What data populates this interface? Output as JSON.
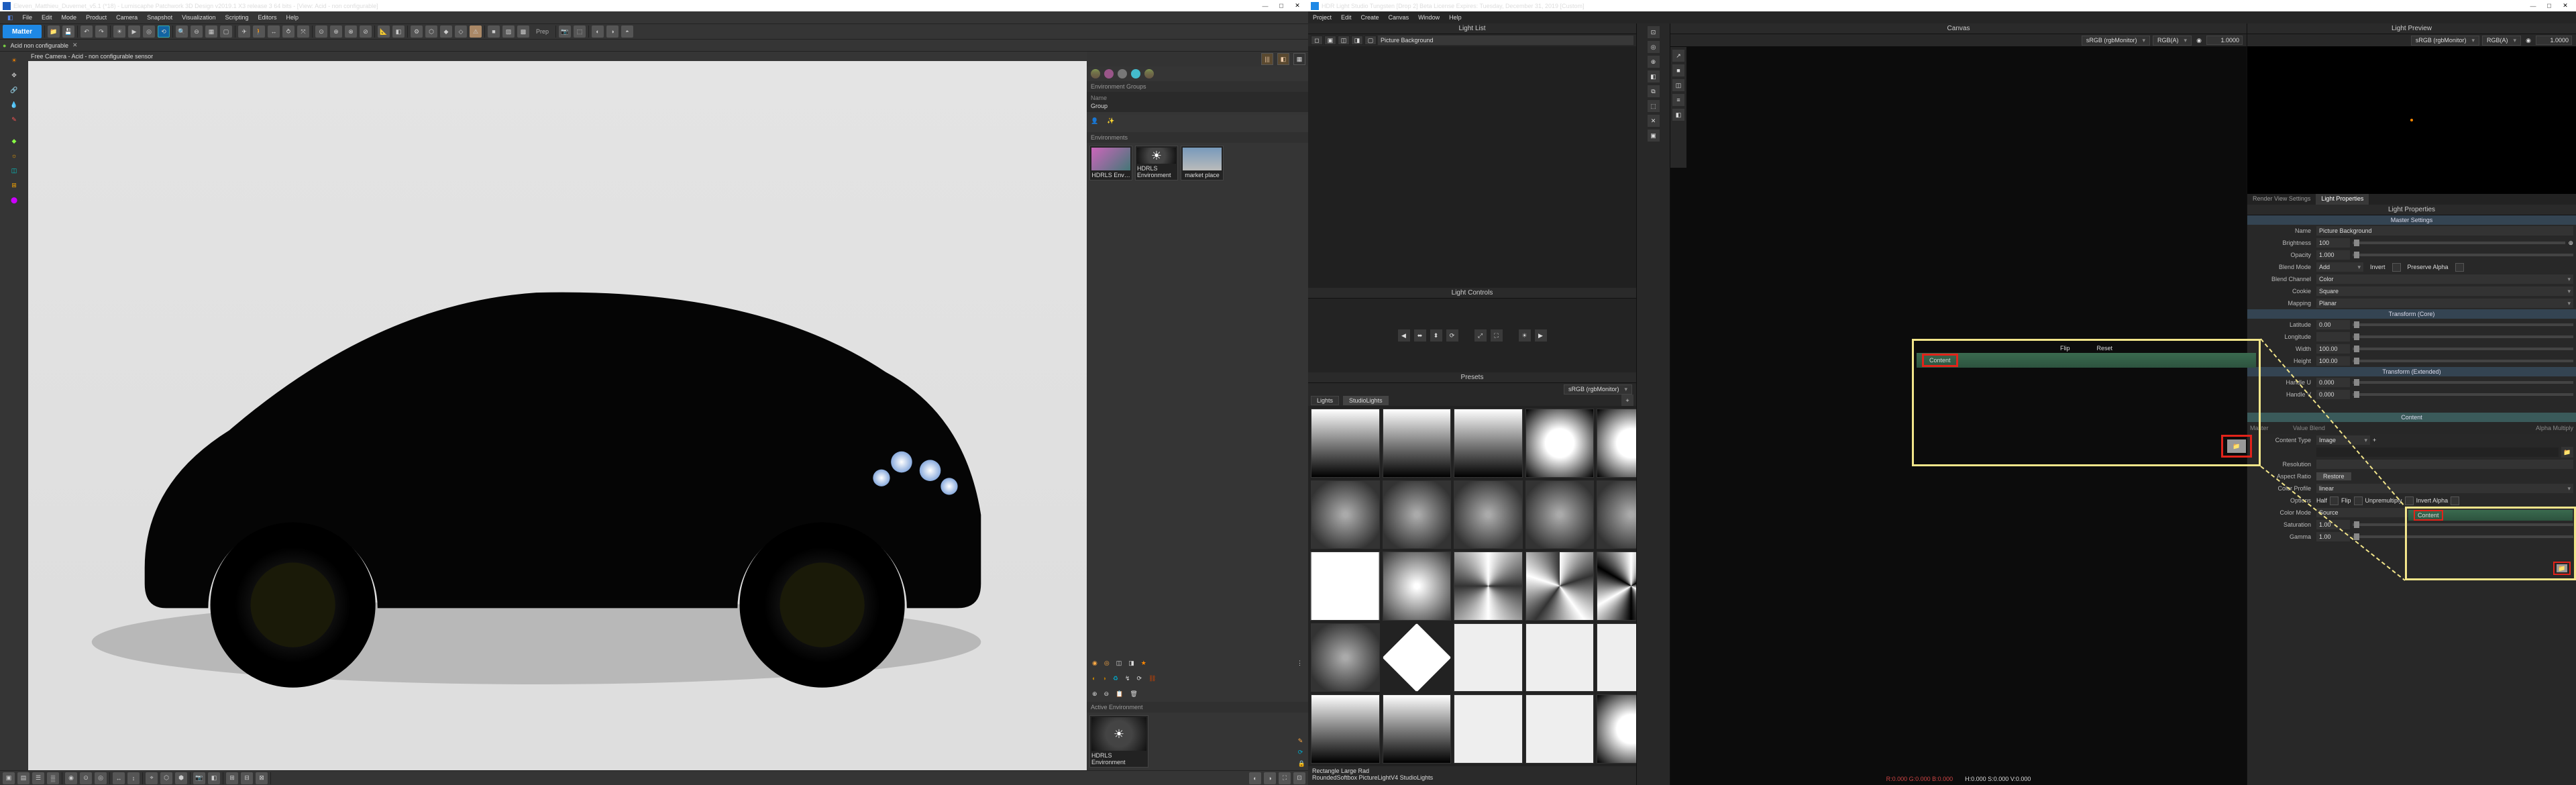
{
  "left": {
    "title": "Eleven_Matthieu_Duvernet_v5.1 (*18) - Lumiscaphe Patchwork 3D Design v2019.1 X3 release 3  64 bits - [View: Acid - non configurable]",
    "menu": [
      "File",
      "Edit",
      "Mode",
      "Product",
      "Camera",
      "Snapshot",
      "Visualization",
      "Scripting",
      "Editors",
      "Help"
    ],
    "matter_btn": "Matter",
    "breadcrumb": "Acid  non configurable",
    "viewport_header": "Free Camera - Acid - non configurable sensor",
    "envgroups_label": "Environment Groups",
    "env_name_label": "Name",
    "env_name_value": "Group",
    "environments_label": "Environments",
    "env_thumbs": [
      {
        "name": "HDRLS Env…"
      },
      {
        "name": "HDRLS Environment"
      },
      {
        "name": "market place"
      }
    ],
    "active_env_label": "Active Environment",
    "active_env_name": "HDRLS Environment"
  },
  "right": {
    "title": "HDR Light Studio Tungsten [Drop 2] Beta License Expires: Tuesday, December 31, 2019  [Custom]",
    "menu": [
      "Project",
      "Edit",
      "Create",
      "Canvas",
      "Window",
      "Help"
    ],
    "panels": {
      "light_list": "Light List",
      "light_controls": "Light Controls",
      "presets": "Presets",
      "canvas": "Canvas",
      "light_preview": "Light Preview",
      "render_view_settings": "Render View Settings",
      "light_properties": "Light Properties"
    },
    "light_list_item": "Picture Background",
    "presets_segments": [
      "Lights",
      "StudioLights"
    ],
    "presets_colorspace": "sRGB (rgbMonitor)",
    "preset_selected_name": "Rectangle Large Rad",
    "preset_selected_path": "RoundedSoftbox PictureLightV4 StudioLights",
    "canvas": {
      "colorspace": "sRGB (rgbMonitor)",
      "channel": "RGB(A)",
      "exposure": "1.0000",
      "rgb": "R:0.000 G:0.000 B:0.000",
      "coords_h": "H:0.000 S:0.000 V:0.000"
    },
    "preview": {
      "colorspace": "sRGB (rgbMonitor)",
      "channel": "RGB(A)",
      "exposure": "1.0000"
    },
    "props": {
      "master_settings": "Master Settings",
      "name_label": "Name",
      "name_value": "Picture Background",
      "brightness_label": "Brightness",
      "brightness_value": "100",
      "opacity_label": "Opacity",
      "opacity_value": "1.000",
      "blend_mode_label": "Blend Mode",
      "blend_mode_value": "Add",
      "invert_label": "Invert",
      "preserve_alpha_label": "Preserve Alpha",
      "blend_channel_label": "Blend Channel",
      "blend_channel_value": "Color",
      "cookie_label": "Cookie",
      "cookie_value": "Square",
      "mapping_label": "Mapping",
      "mapping_value": "Planar",
      "transform_core": "Transform (Core)",
      "latitude_label": "Latitude",
      "latitude_value": "0.00",
      "longitude_label": "Longitude",
      "width_label": "Width",
      "width_value": "100.00",
      "height_label": "Height",
      "height_value": "100.00",
      "transform_ext": "Transform (Extended)",
      "handle_u_label": "Handle U",
      "handle_u_value": "0.000",
      "handle_v_label": "Handle V",
      "handle_v_value": "0.000",
      "content_head": "Content",
      "value_blend_label": "Value Blend",
      "alpha_mult_label": "Alpha Multiply",
      "content_type_label": "Content Type",
      "content_type_value": "Image",
      "resolution_label": "Resolution",
      "aspect_ratio_label": "Aspect Ratio",
      "aspect_restore": "Restore",
      "color_profile_label": "Color Profile",
      "color_profile_value": "linear",
      "options_label": "Options",
      "opt_half": "Half",
      "opt_flip": "Flip",
      "opt_unprem": "Unpremultiply",
      "opt_inva": "Invert Alpha",
      "color_mode_label": "Color Mode",
      "color_mode_value": "Source",
      "saturation_label": "Saturation",
      "saturation_value": "1.00",
      "gamma_label": "Gamma",
      "gamma_value": "1.00"
    },
    "annotations": {
      "content_tag": "Content"
    }
  }
}
